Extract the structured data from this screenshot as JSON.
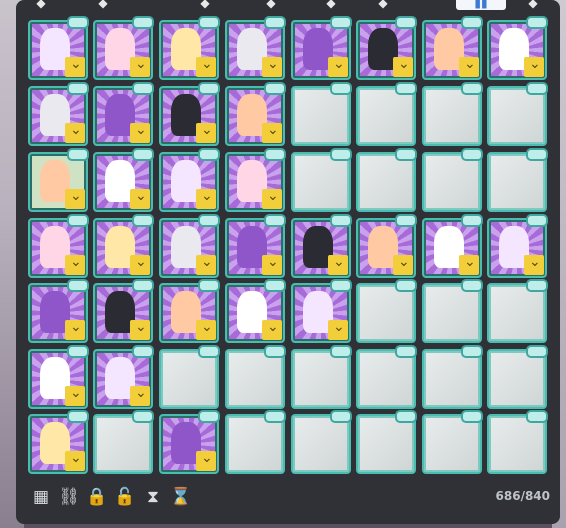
{
  "window": {
    "title": ""
  },
  "tabs": [
    {
      "id": "t1",
      "icon": "tab-icon-1",
      "active": false
    },
    {
      "id": "t2",
      "icon": "tab-icon-2",
      "active": false
    },
    {
      "id": "t3",
      "icon": "tab-icon-3",
      "active": false
    },
    {
      "id": "t4",
      "icon": "tab-icon-4",
      "active": false
    },
    {
      "id": "t5",
      "icon": "tab-icon-5",
      "active": false
    },
    {
      "id": "t6",
      "icon": "tab-icon-6",
      "active": false
    },
    {
      "id": "t7",
      "icon": "tab-icon-7",
      "active": true
    },
    {
      "id": "t8",
      "icon": "tab-icon-8",
      "active": false
    }
  ],
  "inventory": {
    "count": "686/840",
    "rows": [
      [
        "filled",
        "filled",
        "filled",
        "filled",
        "filled",
        "filled",
        "filled",
        "filled"
      ],
      [
        "filled",
        "filled",
        "filled",
        "filled",
        "empty",
        "empty",
        "empty",
        "empty"
      ],
      [
        "green",
        "filled",
        "filled",
        "filled",
        "empty",
        "empty",
        "empty",
        "empty"
      ],
      [
        "filled",
        "filled",
        "filled",
        "filled",
        "filled",
        "filled",
        "filled",
        "filled"
      ],
      [
        "filled",
        "filled",
        "filled",
        "filled",
        "filled",
        "empty",
        "empty",
        "empty"
      ],
      [
        "filled",
        "filled",
        "empty",
        "empty",
        "empty",
        "empty",
        "empty",
        "empty"
      ],
      [
        "filled",
        "empty",
        "filled",
        "empty",
        "empty",
        "empty",
        "empty",
        "empty"
      ]
    ]
  },
  "toolbar": {
    "items": [
      {
        "name": "grid-view-icon",
        "glyph": "▦"
      },
      {
        "name": "link-icon",
        "glyph": "⛓"
      },
      {
        "name": "lock-icon",
        "glyph": "🔒"
      },
      {
        "name": "unlock-icon",
        "glyph": "🔓"
      },
      {
        "name": "hourglass-icon",
        "glyph": "⧗"
      },
      {
        "name": "hourglass-reset-icon",
        "glyph": "⌛"
      }
    ]
  }
}
